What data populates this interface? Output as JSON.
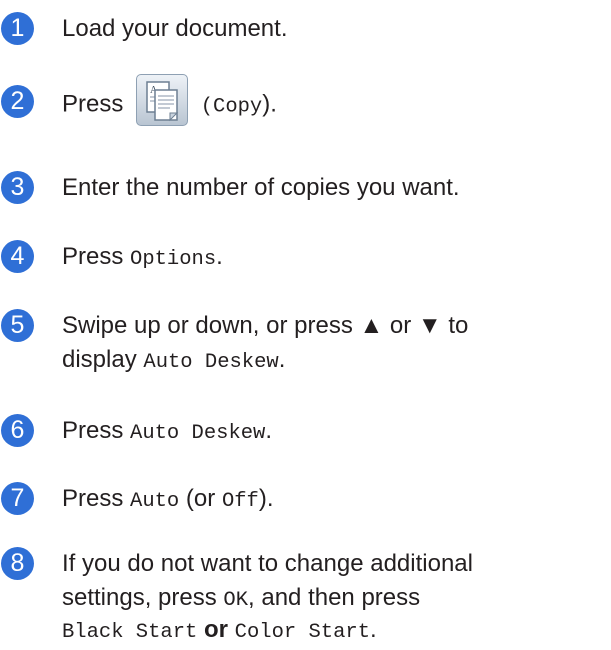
{
  "steps": [
    {
      "n": "1",
      "text": "Load your document."
    },
    {
      "n": "2",
      "pre": "Press",
      "icon": "copy-icon",
      "paren_open": "(",
      "code": "Copy",
      "paren_close": ")."
    },
    {
      "n": "3",
      "text": "Enter the number of copies you want."
    },
    {
      "n": "4",
      "pre": "Press",
      "code": "Options",
      "post": "."
    },
    {
      "n": "5",
      "line1": "Swipe up or down, or press ▲ or ▼ to",
      "pre2": "display",
      "code": "Auto Deskew",
      "post": "."
    },
    {
      "n": "6",
      "pre": "Press",
      "code": "Auto Deskew",
      "post": "."
    },
    {
      "n": "7",
      "pre": "Press",
      "code": "Auto",
      "mid": "(or",
      "code2": "Off",
      "post": ")."
    },
    {
      "n": "8",
      "line1": "If you do not want to change additional",
      "pre2": "settings, press",
      "code": "OK",
      "mid2": ", and then press",
      "code2": "Black Start",
      "or": "or",
      "code3": "Color Start",
      "post": "."
    }
  ],
  "colors": {
    "badge": "#2f6fd6",
    "text": "#231f20"
  }
}
